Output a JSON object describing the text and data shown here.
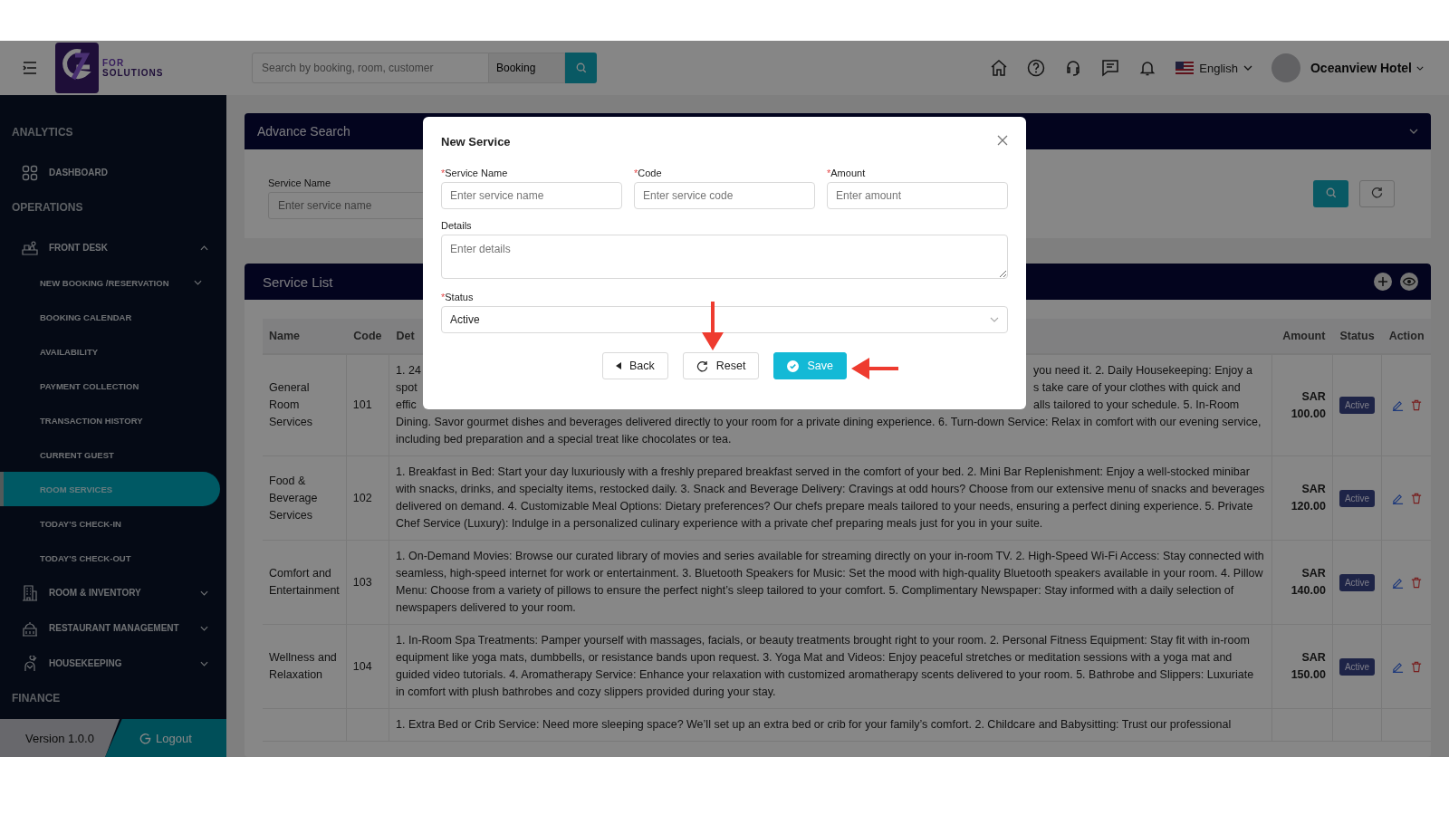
{
  "topbar": {
    "logo": {
      "line_1": "FOR",
      "line_2": "SOLUTIONS"
    },
    "search": {
      "placeholder": "Search by booking, room, customer"
    },
    "search_scope": "Booking",
    "language": "English",
    "user": "Oceanview Hotel"
  },
  "sidebar": {
    "items": [
      {
        "kind": "section",
        "label": "ANALYTICS"
      },
      {
        "kind": "link",
        "label": "DASHBOARD"
      },
      {
        "kind": "section",
        "label": "OPERATIONS"
      },
      {
        "kind": "group",
        "label": "FRONT DESK",
        "expanded": true,
        "children": [
          {
            "kind": "group",
            "label": "NEW BOOKING /RESERVATION",
            "expanded": false
          },
          {
            "kind": "link",
            "label": "BOOKING CALENDAR",
            "selected": false
          },
          {
            "kind": "link",
            "label": "AVAILABILITY",
            "selected": false
          },
          {
            "kind": "link",
            "label": "PAYMENT COLLECTION",
            "selected": false
          },
          {
            "kind": "link",
            "label": "TRANSACTION HISTORY",
            "selected": false
          },
          {
            "kind": "link",
            "label": "CURRENT GUEST",
            "selected": false
          },
          {
            "kind": "link",
            "label": "ROOM SERVICES",
            "selected": true
          },
          {
            "kind": "link",
            "label": "TODAY'S CHECK-IN",
            "selected": false
          },
          {
            "kind": "link",
            "label": "TODAY'S CHECK-OUT",
            "selected": false
          }
        ]
      },
      {
        "kind": "group",
        "label": "ROOM & INVENTORY",
        "expanded": false
      },
      {
        "kind": "group",
        "label": "RESTAURANT MANAGEMENT",
        "expanded": false
      },
      {
        "kind": "group",
        "label": "HOUSEKEEPING",
        "expanded": false
      },
      {
        "kind": "section",
        "label": "FINANCE"
      }
    ],
    "version": "Version 1.0.0",
    "logout": "Logout"
  },
  "advance_search": {
    "title": "Advance Search",
    "field_label": "Service Name",
    "placeholder": "Enter service name"
  },
  "service_list": {
    "title": "Service List",
    "columns": [
      "Name",
      "Code",
      "Det",
      "Amount",
      "Status",
      "Action"
    ],
    "rows": [
      {
        "name": "General Room Services",
        "code": "101",
        "details_lines": [
          {
            "left": "1. 24",
            "right": "you need it. 2. Daily Housekeeping: Enjoy a"
          },
          {
            "left": "spot",
            "right": "s take care of your clothes with quick and"
          },
          {
            "left": "effic",
            "right": "alls tailored to your schedule. 5. In-Room"
          },
          {
            "left": "Dining. Savor gourmet dishes and beverages delivered directly to your room for a private dining experience. 6. Turn-down Service: Relax in comfort with our evening service,"
          },
          {
            "left": "including bed preparation and a special treat like chocolates or tea."
          }
        ],
        "amount": "SAR 100.00",
        "status": "Active"
      },
      {
        "name": "Food & Beverage Services",
        "code": "102",
        "details": "1. Breakfast in Bed: Start your day luxuriously with a freshly prepared breakfast served in the comfort of your bed. 2. Mini Bar Replenishment: Enjoy a well-stocked minibar with snacks, drinks, and specialty items, restocked daily. 3. Snack and Beverage Delivery: Cravings at odd hours? Choose from our extensive menu of snacks and beverages delivered on demand. 4. Customizable Meal Options: Dietary preferences? Our chefs prepare meals tailored to your needs, ensuring a perfect dining experience. 5. Private Chef Service (Luxury): Indulge in a personalized culinary experience with a private chef preparing meals just for you in your suite.",
        "amount": "SAR 120.00",
        "status": "Active"
      },
      {
        "name": "Comfort and Entertainment",
        "code": "103",
        "details": "1. On-Demand Movies: Browse our curated library of movies and series available for streaming directly on your in-room TV. 2. High-Speed Wi-Fi Access: Stay connected with seamless, high-speed internet for work or entertainment. 3. Bluetooth Speakers for Music: Set the mood with high-quality Bluetooth speakers available in your room. 4. Pillow Menu: Choose from a variety of pillows to ensure the perfect night’s sleep tailored to your comfort. 5. Complimentary Newspaper: Stay informed with a daily selection of newspapers delivered to your room.",
        "amount": "SAR 140.00",
        "status": "Active"
      },
      {
        "name": "Wellness and Relaxation",
        "code": "104",
        "details": "1. In-Room Spa Treatments: Pamper yourself with massages, facials, or beauty treatments brought right to your room. 2. Personal Fitness Equipment: Stay fit with in-room equipment like yoga mats, dumbbells, or resistance bands upon request. 3. Yoga Mat and Videos: Enjoy peaceful stretches or meditation sessions with a yoga mat and guided video tutorials. 4. Aromatherapy Service: Enhance your relaxation with customized aromatherapy scents delivered to your room. 5. Bathrobe and Slippers: Luxuriate in comfort with plush bathrobes and cozy slippers provided during your stay.",
        "amount": "SAR 150.00",
        "status": "Active"
      },
      {
        "details": "1. Extra Bed or Crib Service: Need more sleeping space? We’ll set up an extra bed or crib for your family’s comfort. 2. Childcare and Babysitting: Trust our professional"
      }
    ]
  },
  "modal": {
    "title": "New Service",
    "fields": [
      {
        "required_mark": "*",
        "label": "Service Name",
        "placeholder": "Enter service name"
      },
      {
        "required_mark": "*",
        "label": "Code",
        "placeholder": "Enter service code"
      },
      {
        "required_mark": "*",
        "label": "Amount",
        "placeholder": "Enter amount"
      }
    ],
    "details": {
      "label": "Details",
      "placeholder": "Enter details"
    },
    "status": {
      "required_mark": "*",
      "label": "Status",
      "value": "Active"
    },
    "buttons": [
      {
        "kind": "back",
        "label": "Back"
      },
      {
        "kind": "reset",
        "label": "Reset"
      },
      {
        "kind": "save",
        "label": "Save"
      }
    ]
  }
}
